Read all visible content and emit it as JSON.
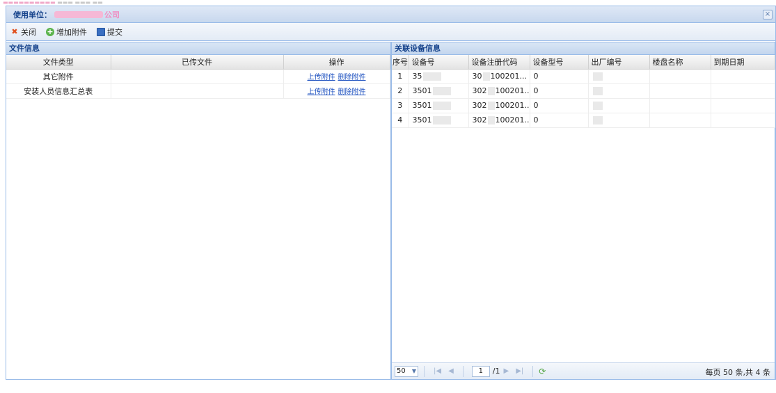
{
  "window": {
    "title_label": "使用单位：",
    "title_value_tail": "公司",
    "close_glyph": "×"
  },
  "toolbar": {
    "close_label": "关闭",
    "add_attachment_label": "增加附件",
    "submit_label": "提交"
  },
  "file_panel": {
    "title": "文件信息",
    "columns": [
      "文件类型",
      "已传文件",
      "操作"
    ],
    "rows": [
      {
        "type": "其它附件",
        "uploaded": "",
        "upload_link": "上传附件",
        "delete_link": "删除附件"
      },
      {
        "type": "安装人员信息汇总表",
        "uploaded": "",
        "upload_link": "上传附件",
        "delete_link": "删除附件"
      }
    ]
  },
  "device_panel": {
    "title": "关联设备信息",
    "columns": [
      "序号",
      "设备号",
      "设备注册代码",
      "设备型号",
      "出厂编号",
      "楼盘名称",
      "到期日期"
    ],
    "rows": [
      {
        "seq": "1",
        "device_no": "35",
        "reg_code_a": "30",
        "reg_code_b": "100201...",
        "model": "0"
      },
      {
        "seq": "2",
        "device_no": "3501",
        "reg_code_a": "302",
        "reg_code_b": "100201...",
        "model": "0"
      },
      {
        "seq": "3",
        "device_no": "3501",
        "reg_code_a": "302",
        "reg_code_b": "100201...",
        "model": "0"
      },
      {
        "seq": "4",
        "device_no": "3501",
        "reg_code_a": "302",
        "reg_code_b": "100201...",
        "model": "0"
      }
    ]
  },
  "pager": {
    "page_size": "50",
    "current_page": "1",
    "total_pages": "/1",
    "summary": "每页 50 条,共 4 条"
  }
}
